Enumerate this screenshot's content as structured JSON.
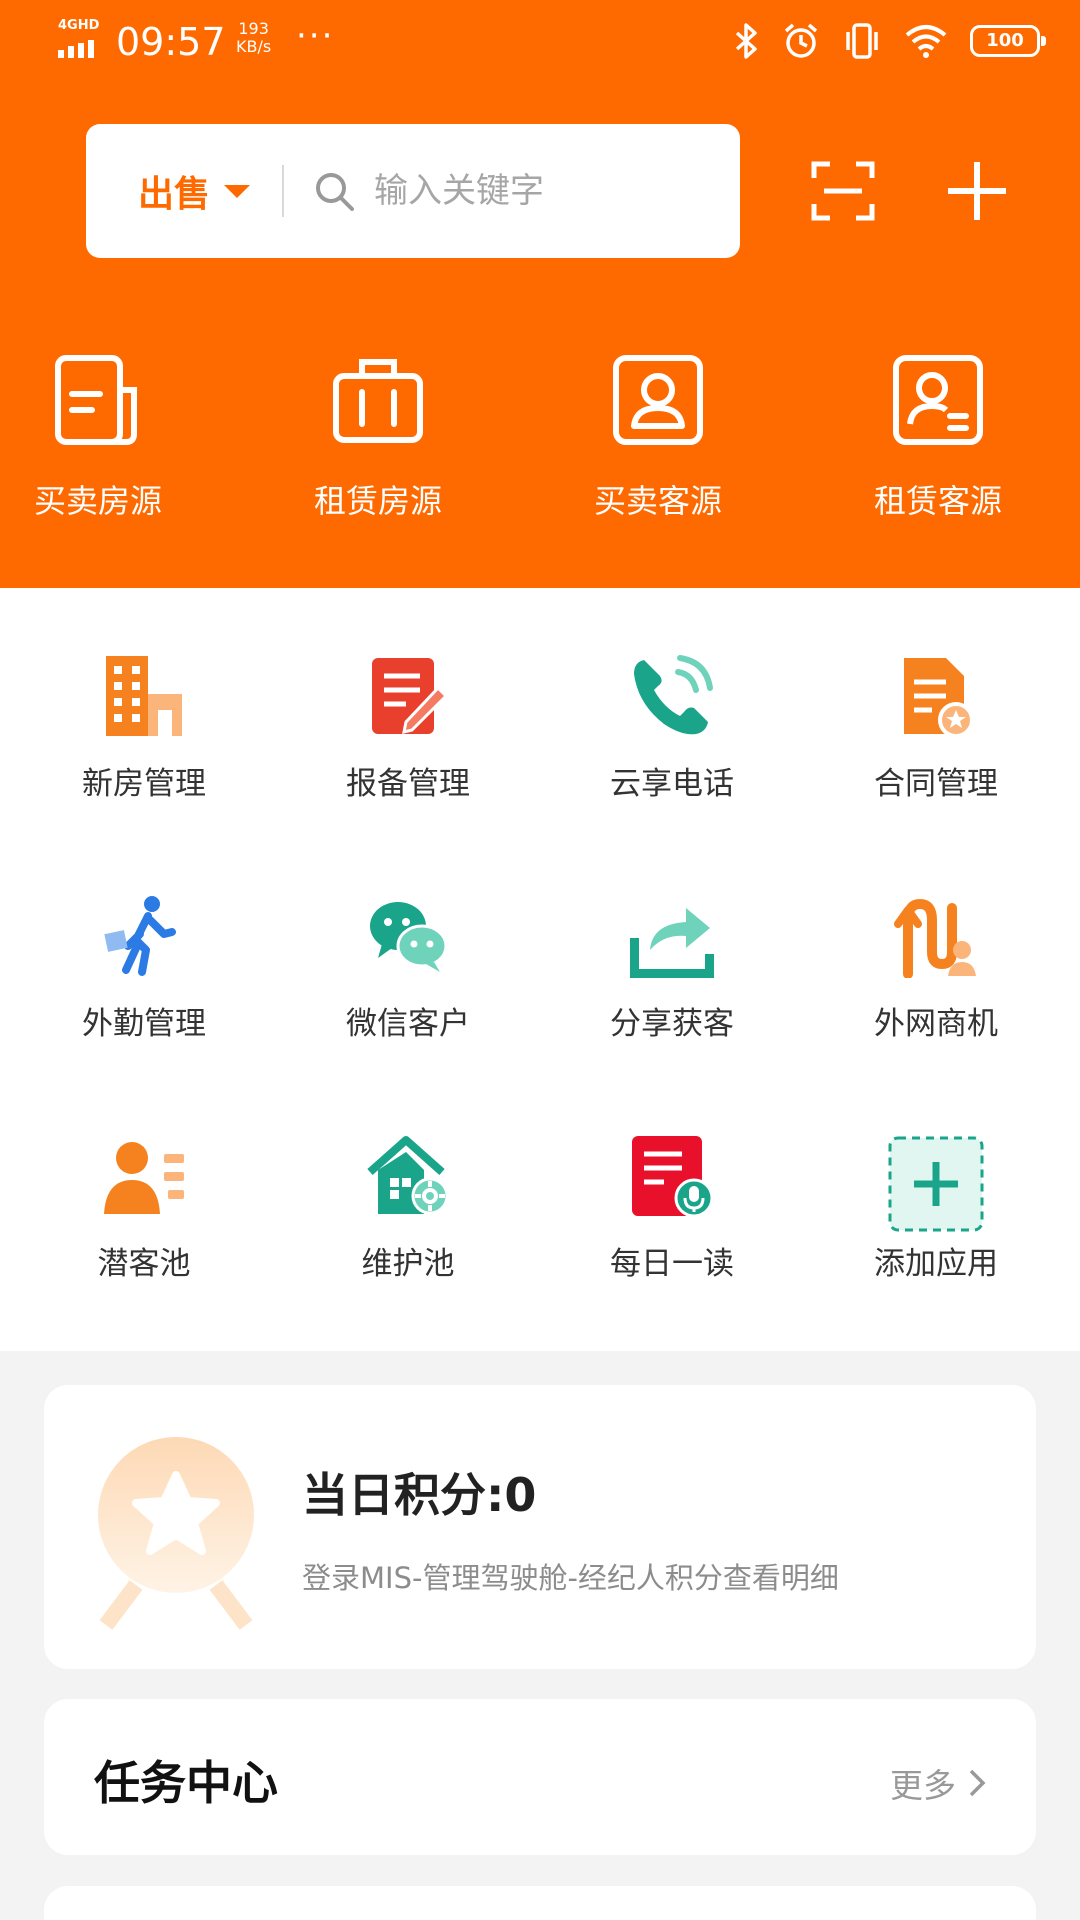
{
  "status_bar": {
    "network": "4GHD",
    "time": "09:57",
    "speed_value": "193",
    "speed_unit": "KB/s",
    "more_dots": "···",
    "battery": "100"
  },
  "search": {
    "type_label": "出售",
    "placeholder": "输入关键字"
  },
  "quick_entries": [
    {
      "label": "买卖房源",
      "icon": "document-icon"
    },
    {
      "label": "租赁房源",
      "icon": "briefcase-icon"
    },
    {
      "label": "买卖客源",
      "icon": "user-card-icon"
    },
    {
      "label": "租赁客源",
      "icon": "user-card-lines-icon"
    }
  ],
  "apps": [
    {
      "label": "新房管理",
      "icon": "building-icon"
    },
    {
      "label": "报备管理",
      "icon": "report-edit-icon"
    },
    {
      "label": "云享电话",
      "icon": "phone-icon"
    },
    {
      "label": "合同管理",
      "icon": "contract-icon"
    },
    {
      "label": "外勤管理",
      "icon": "walking-person-icon"
    },
    {
      "label": "微信客户",
      "icon": "wechat-icon"
    },
    {
      "label": "分享获客",
      "icon": "share-icon"
    },
    {
      "label": "外网商机",
      "icon": "route-user-icon"
    },
    {
      "label": "潜客池",
      "icon": "user-list-icon"
    },
    {
      "label": "维护池",
      "icon": "house-gear-icon"
    },
    {
      "label": "每日一读",
      "icon": "reading-mic-icon"
    },
    {
      "label": "添加应用",
      "icon": "add-app-icon"
    }
  ],
  "points": {
    "title": "当日积分:0",
    "subtitle": "登录MIS-管理驾驶舱-经纪人积分查看明细"
  },
  "tasks": {
    "title": "任务中心",
    "more": "更多"
  },
  "colors": {
    "primary": "#ff6a00",
    "orange_icon": "#f5821f",
    "teal_icon": "#1aa58a",
    "red_icon": "#e8402c",
    "blue_icon": "#2c7be5"
  }
}
